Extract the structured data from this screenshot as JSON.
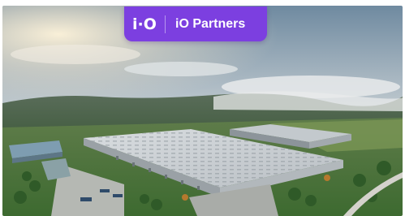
{
  "brand": {
    "mark": "i·O",
    "name": "iO Partners",
    "accent_color": "#7c3fe0"
  },
  "photo": {
    "subject": "aerial-warehouse-logistics-park"
  }
}
